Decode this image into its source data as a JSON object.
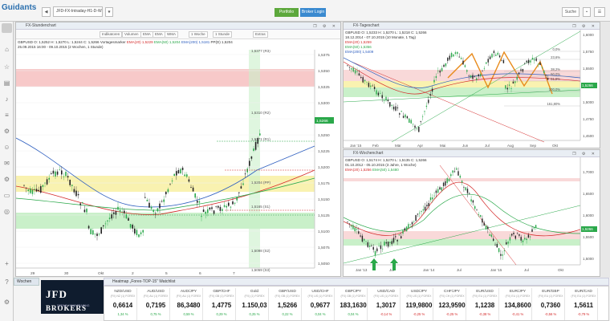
{
  "app": {
    "logo": "Guidants",
    "logo_sub": "powered by",
    "tab_title": "JFD-FX-Intraday-H1-D-W",
    "portfolio_btn": "Portfolio",
    "broker_btn": "Broker Login",
    "search_label": "Suche",
    "menu_label": "Menü"
  },
  "sidebar": {
    "items": [
      "house-icon",
      "star-icon",
      "chart-icon",
      "bell-icon",
      "list-icon",
      "gear-icon",
      "user-icon",
      "chat-icon",
      "settings-icon",
      "plus-icon",
      "question-icon"
    ]
  },
  "hourly": {
    "title": "FX-Stundenchart",
    "toolbar": [
      "Indikatoren",
      "Volumen",
      "EMA",
      "EMA",
      "WMA",
      "1 Woche",
      "1 Stunde",
      "Extras"
    ],
    "legend_line1": "GBPUSD O: 1,5252 H: 1,5270 L: 1,5244 C: 1,5266",
    "legend_line1_b": "Vortagesmarker",
    "legend_ema20": "EMA(20) 1,5229",
    "legend_ema50": "EMA(50) 1,5204",
    "legend_ema200": "EMA(200) 1,5181",
    "legend_pp": "PP(D) 1,5204",
    "date_range": "25.09.2015 16:00 - 09.10.2015 (2 Wochen, 1 Stunde)",
    "y_labels": [
      "1,5375",
      "1,5350",
      "1,5325",
      "1,5300",
      "1,5275",
      "1,5250",
      "1,5225",
      "1,5200",
      "1,5175",
      "1,5150",
      "1,5125",
      "1,5100",
      "1,5075",
      "1,5050"
    ],
    "levels": [
      "1,5377 (R3)",
      "1,5310 (R2)",
      "1,5271 (R1)",
      "1,5204 (PP)",
      "1,5165 (S1)",
      "1,5098 (S2)",
      "1,5059 (S3)"
    ],
    "price_tag": "1,5266",
    "x_labels": [
      "29",
      "30",
      "Okt",
      "2",
      "5",
      "6",
      "7"
    ]
  },
  "daily": {
    "title": "FX-Tageschart",
    "legend_line1": "GBPUSD O: 1,5233 H: 1,5270 L: 1,5218 C: 1,5266",
    "date_range": "18.12.2014 - 07.10.2015 (10 Monate, 1 Tag)",
    "legend_ema20": "EMA(20) 1,5259",
    "legend_ema50": "EMA(50) 1,5356",
    "legend_ema200": "EMA(200) 1,5409",
    "y_labels": [
      "1,6000",
      "1,5750",
      "1,5500",
      "1,5250",
      "1,5000",
      "1,4750",
      "1,4500"
    ],
    "fib_labels": [
      "0,0%",
      "23,6%",
      "38,2%",
      "50,0%",
      "61,8%",
      "100,0%",
      "161,80%"
    ],
    "price_tag": "1,5266",
    "x_labels": [
      "Jan '15",
      "Feb",
      "Mär",
      "Apr",
      "Mai",
      "Jun",
      "Jul",
      "Aug",
      "Sep",
      "Okt"
    ]
  },
  "weekly": {
    "title": "FX-Wochenchart",
    "legend_line1": "GBPUSD O: 1,5174 H: 1,5270 L: 1,5135 C: 1,5266",
    "date_range": "01.10.2012 - 05.10.2015 (3 Jahre, 1 Woche)",
    "legend_ema20": "EMA(20) 1,5256",
    "legend_ema50": "EMA(50) 1,5480",
    "y_labels": [
      "1,7000",
      "1,6500",
      "1,6000",
      "1,5500",
      "1,5000"
    ],
    "price_tag": "1,5266",
    "x_labels": [
      "Jan '13",
      "Jul",
      "Jan '14",
      "Jul",
      "Jan '15",
      "Jul",
      "Okt"
    ]
  },
  "bottom": {
    "tab_label": "Wochen",
    "watchlist_title": "Heatmap „Forex-TOP-15“ Watchlist",
    "jfd_logo": "JFD",
    "jfd_logo2": "BROKERS",
    "jfd_sub": "DEFINE YOUR TRADING",
    "tickers": [
      {
        "name": "NZD/USD",
        "sub": "(FX) NZ (1) FOREX",
        "value": "0,6614",
        "change": "1,34 %"
      },
      {
        "name": "AUD/USD",
        "sub": "(FX) AU (1) FOREX",
        "value": "0,7195",
        "change": "0,75 %"
      },
      {
        "name": "AUD/JPY",
        "sub": "(FX) AU (1) FOREX",
        "value": "86,3480",
        "change": "0,59 %"
      },
      {
        "name": "GBP/CHF",
        "sub": "(FX) GB (1) FOREX",
        "value": "1,4775",
        "change": "0,29 %"
      },
      {
        "name": "Gold",
        "sub": "(FX) (1) FOREX",
        "value": "1.150,03",
        "change": "0,25 %"
      },
      {
        "name": "GBP/USD",
        "sub": "(FX) GB (1) FOREX",
        "value": "1,5266",
        "change": "0,22 %"
      },
      {
        "name": "USD/CHF",
        "sub": "(FX) US (1) FOREX",
        "value": "0,9677",
        "change": "0,04 %"
      },
      {
        "name": "GBP/JPY",
        "sub": "(FX) GB (1) FOREX",
        "value": "183,1630",
        "change": "0,04 %"
      },
      {
        "name": "USD/CAD",
        "sub": "(FX) US (1) FOREX",
        "value": "1,3017",
        "change": "-0,14 %"
      },
      {
        "name": "USD/JPY",
        "sub": "(FX) US (1) FOREX",
        "value": "119,9800",
        "change": "-0,25 %"
      },
      {
        "name": "CHF/JPY",
        "sub": "(FX) CH (1) FOREX",
        "value": "123,9590",
        "change": "-0,25 %"
      },
      {
        "name": "EUR/USD",
        "sub": "(FX) EU (1) FOREX",
        "value": "1,1238",
        "change": "-0,38 %"
      },
      {
        "name": "EUR/JPY",
        "sub": "(FX) EU (1) FOREX",
        "value": "134,8600",
        "change": "-0,41 %"
      },
      {
        "name": "EUR/GBP",
        "sub": "(FX) EU (1) FOREX",
        "value": "0,7360",
        "change": "-0,56 %"
      },
      {
        "name": "EUR/CAD",
        "sub": "(FX) EU (1) FOREX",
        "value": "1,5611",
        "change": "-0,79 %"
      }
    ]
  },
  "colors": {
    "bull": "#2aa84a",
    "bear": "#d42a2a",
    "band_red": "#f7c9c9",
    "band_yellow": "#f9f2b0",
    "band_green": "#c9f0c9"
  }
}
